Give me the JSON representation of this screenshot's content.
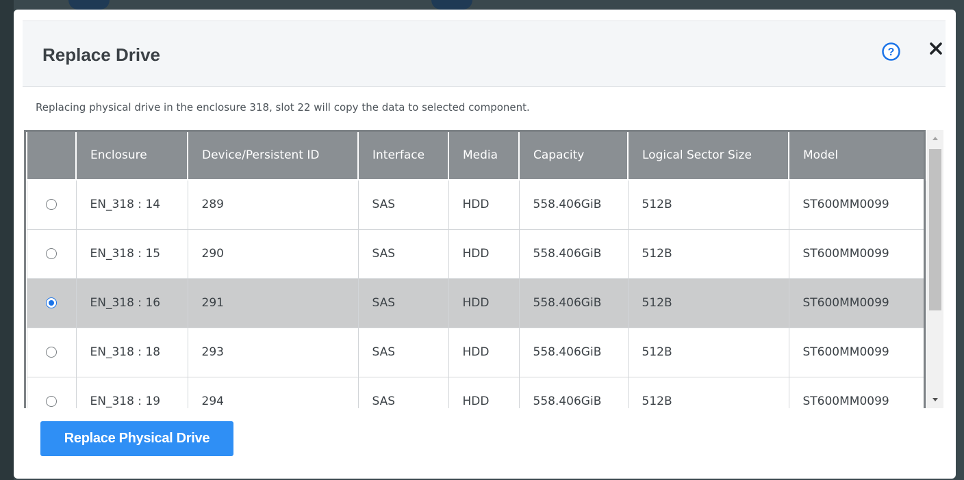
{
  "dialog": {
    "title": "Replace Drive",
    "help_icon": "help-circle-icon",
    "close_icon": "close-icon",
    "description": "Replacing physical drive in the enclosure 318, slot 22 will copy the data to selected component."
  },
  "table": {
    "columns": [
      "",
      "Enclosure",
      "Device/Persistent ID",
      "Interface",
      "Media",
      "Capacity",
      "Logical Sector Size",
      "Model"
    ],
    "rows": [
      {
        "selected": false,
        "enclosure": "EN_318 : 14",
        "device_id": "289",
        "interface": "SAS",
        "media": "HDD",
        "capacity": "558.406GiB",
        "sector_size": "512B",
        "model": "ST600MM0099"
      },
      {
        "selected": false,
        "enclosure": "EN_318 : 15",
        "device_id": "290",
        "interface": "SAS",
        "media": "HDD",
        "capacity": "558.406GiB",
        "sector_size": "512B",
        "model": "ST600MM0099"
      },
      {
        "selected": true,
        "enclosure": "EN_318 : 16",
        "device_id": "291",
        "interface": "SAS",
        "media": "HDD",
        "capacity": "558.406GiB",
        "sector_size": "512B",
        "model": "ST600MM0099"
      },
      {
        "selected": false,
        "enclosure": "EN_318 : 18",
        "device_id": "293",
        "interface": "SAS",
        "media": "HDD",
        "capacity": "558.406GiB",
        "sector_size": "512B",
        "model": "ST600MM0099"
      },
      {
        "selected": false,
        "enclosure": "EN_318 : 19",
        "device_id": "294",
        "interface": "SAS",
        "media": "HDD",
        "capacity": "558.406GiB",
        "sector_size": "512B",
        "model": "ST600MM0099"
      }
    ]
  },
  "actions": {
    "replace_label": "Replace Physical Drive"
  },
  "colors": {
    "accent": "#2f8ff5",
    "header_bg": "#8a8f93",
    "selected_row": "#cbcccd",
    "radio_checked": "#1a73e8"
  }
}
